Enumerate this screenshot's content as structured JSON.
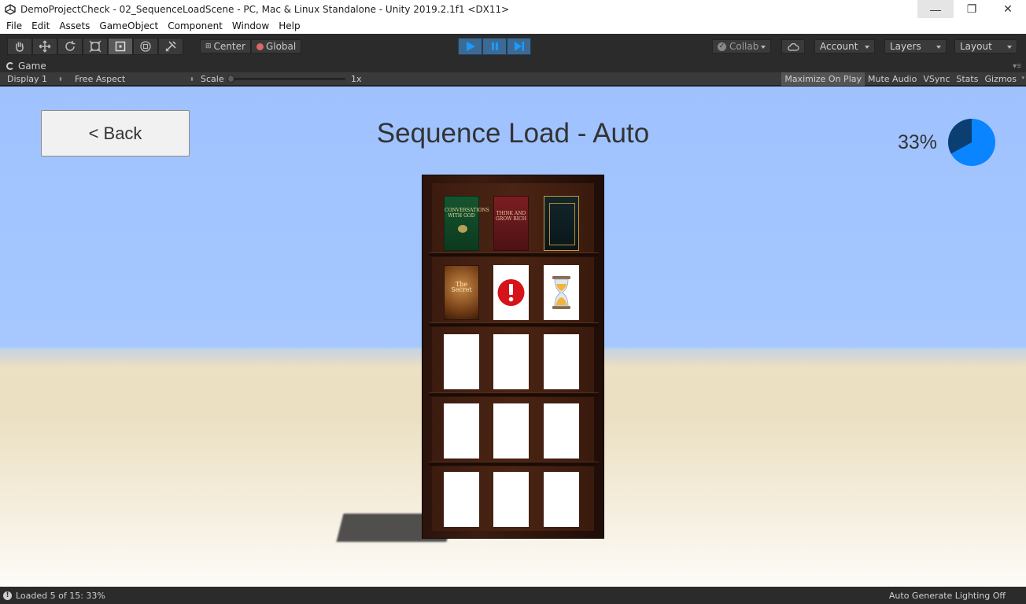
{
  "window": {
    "title": "DemoProjectCheck - 02_SequenceLoadScene - PC, Mac & Linux Standalone - Unity 2019.2.1f1 <DX11>",
    "minimize": "—",
    "maximize": "❐",
    "close": "✕"
  },
  "menu": [
    "File",
    "Edit",
    "Assets",
    "GameObject",
    "Component",
    "Window",
    "Help"
  ],
  "toolbar": {
    "tools": [
      "hand-tool",
      "move-tool",
      "rotate-tool",
      "scale-tool",
      "rect-tool",
      "transform-tool",
      "custom-tool"
    ],
    "active_tool": "rect-tool",
    "pivot_mode": "Center",
    "pivot_rotation": "Global",
    "collab": "Collab",
    "account": "Account",
    "layers": "Layers",
    "layout": "Layout"
  },
  "game_tab": {
    "label": "Game",
    "display": "Display 1",
    "aspect": "Free Aspect",
    "scale_label": "Scale",
    "scale_value": "1x",
    "maximize_on_play": "Maximize On Play",
    "mute_audio": "Mute Audio",
    "vsync": "VSync",
    "stats": "Stats",
    "gizmos": "Gizmos"
  },
  "scene": {
    "back_label": "< Back",
    "title": "Sequence Load - Auto",
    "progress_text": "33%",
    "progress_fraction": 0.33,
    "progress_color": "#0a84ff",
    "progress_dark_color": "#0b3f72"
  },
  "shelf": {
    "rows": [
      [
        "book-green",
        "book-red",
        "book-dark"
      ],
      [
        "book-secret",
        "error",
        "loading"
      ],
      [
        "empty",
        "empty",
        "empty"
      ],
      [
        "empty",
        "empty",
        "empty"
      ],
      [
        "empty",
        "empty",
        "empty"
      ]
    ],
    "book_titles": {
      "book-green": "CONVERSATIONS WITH GOD",
      "book-red": "THINK AND GROW RICH",
      "book-dark": "",
      "book-secret": "The Secret"
    }
  },
  "status": {
    "message": "Loaded 5 of 15: 33%",
    "lighting": "Auto Generate Lighting Off"
  }
}
